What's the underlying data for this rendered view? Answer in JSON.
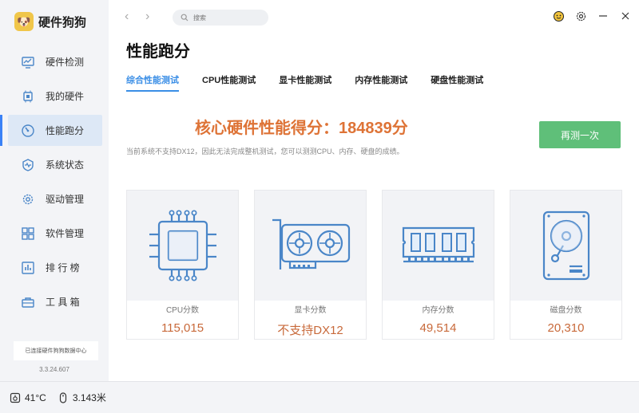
{
  "app": {
    "name": "硬件狗狗",
    "logo_icon": "dog-logo-icon"
  },
  "sidebar": {
    "items": [
      {
        "label": "硬件检测",
        "icon": "monitor-chart-icon"
      },
      {
        "label": "我的硬件",
        "icon": "chip-icon"
      },
      {
        "label": "性能跑分",
        "icon": "speedometer-icon",
        "active": true
      },
      {
        "label": "系统状态",
        "icon": "pulse-shield-icon"
      },
      {
        "label": "驱动管理",
        "icon": "gear-icon"
      },
      {
        "label": "软件管理",
        "icon": "grid-apps-icon"
      },
      {
        "label": "排 行 榜",
        "icon": "ranking-icon"
      },
      {
        "label": "工 具 箱",
        "icon": "toolbox-icon"
      }
    ],
    "connection_status": "已连接硬件狗狗数据中心",
    "version": "3.3.24.607"
  },
  "topbar": {
    "back": "‹",
    "forward": "›",
    "search_placeholder": "搜索",
    "controls": [
      "emoji-feedback-icon",
      "settings-icon",
      "minimize-icon",
      "close-icon"
    ]
  },
  "page": {
    "title": "性能跑分",
    "tabs": [
      "综合性能测试",
      "CPU性能测试",
      "显卡性能测试",
      "内存性能测试",
      "硬盘性能测试"
    ],
    "active_tab": 0,
    "score_text": "核心硬件性能得分：184839分",
    "rerun_label": "再测一次",
    "notice": "当前系统不支持DX12，因此无法完成整机测试，您可以测测CPU、内存、硬盘的成绩。"
  },
  "cards": [
    {
      "label": "CPU分数",
      "value": "115,015",
      "icon": "cpu-icon"
    },
    {
      "label": "显卡分数",
      "value": "不支持DX12",
      "icon": "graphics-card-icon"
    },
    {
      "label": "内存分数",
      "value": "49,514",
      "icon": "memory-icon"
    },
    {
      "label": "磁盘分数",
      "value": "20,310",
      "icon": "hard-disk-icon"
    }
  ],
  "statusbar": {
    "temperature": "41°C",
    "mouse_distance": "3.143米"
  },
  "colors": {
    "accent": "#3a8ee6",
    "score": "#de7336",
    "button": "#5fbf79",
    "icon_blue": "#4a86c8"
  }
}
